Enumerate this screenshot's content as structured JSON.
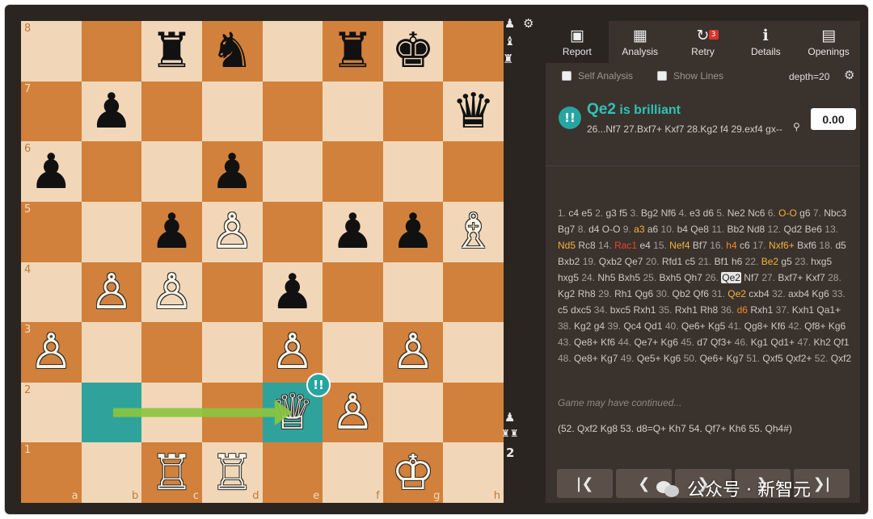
{
  "board": {
    "ranks": [
      "8",
      "7",
      "6",
      "5",
      "4",
      "3",
      "2",
      "1"
    ],
    "files": [
      "a",
      "b",
      "c",
      "d",
      "e",
      "f",
      "g",
      "h"
    ],
    "pieces": [
      {
        "sq": "c8",
        "glyph": "♜",
        "color": "b",
        "name": "black-rook-c8"
      },
      {
        "sq": "d8",
        "glyph": "♞",
        "color": "b",
        "name": "black-knight-d8"
      },
      {
        "sq": "f8",
        "glyph": "♜",
        "color": "b",
        "name": "black-rook-f8"
      },
      {
        "sq": "g8",
        "glyph": "♚",
        "color": "b",
        "name": "black-king-g8"
      },
      {
        "sq": "b7",
        "glyph": "♟",
        "color": "b",
        "name": "black-pawn-b7"
      },
      {
        "sq": "h7",
        "glyph": "♛",
        "color": "b",
        "name": "black-queen-h7"
      },
      {
        "sq": "a6",
        "glyph": "♟",
        "color": "b",
        "name": "black-pawn-a6"
      },
      {
        "sq": "d6",
        "glyph": "♟",
        "color": "b",
        "name": "black-pawn-d6"
      },
      {
        "sq": "c5",
        "glyph": "♟",
        "color": "b",
        "name": "black-pawn-c5"
      },
      {
        "sq": "d5",
        "glyph": "♙",
        "color": "w",
        "name": "white-pawn-d5"
      },
      {
        "sq": "f5",
        "glyph": "♟",
        "color": "b",
        "name": "black-pawn-f5"
      },
      {
        "sq": "g5",
        "glyph": "♟",
        "color": "b",
        "name": "black-pawn-g5"
      },
      {
        "sq": "h5",
        "glyph": "♗",
        "color": "w",
        "name": "white-bishop-h5"
      },
      {
        "sq": "b4",
        "glyph": "♙",
        "color": "w",
        "name": "white-pawn-b4"
      },
      {
        "sq": "c4",
        "glyph": "♙",
        "color": "w",
        "name": "white-pawn-c4"
      },
      {
        "sq": "e4",
        "glyph": "♟",
        "color": "b",
        "name": "black-pawn-e4"
      },
      {
        "sq": "a3",
        "glyph": "♙",
        "color": "w",
        "name": "white-pawn-a3"
      },
      {
        "sq": "e3",
        "glyph": "♙",
        "color": "w",
        "name": "white-pawn-e3"
      },
      {
        "sq": "g3",
        "glyph": "♙",
        "color": "w",
        "name": "white-pawn-g3"
      },
      {
        "sq": "e2",
        "glyph": "♕",
        "color": "w",
        "name": "white-queen-e2"
      },
      {
        "sq": "f2",
        "glyph": "♙",
        "color": "w",
        "name": "white-pawn-f2"
      },
      {
        "sq": "c1",
        "glyph": "♖",
        "color": "w",
        "name": "white-rook-c1"
      },
      {
        "sq": "d1",
        "glyph": "♖",
        "color": "w",
        "name": "white-rook-d1"
      },
      {
        "sq": "g1",
        "glyph": "♔",
        "color": "w",
        "name": "white-king-g1"
      }
    ],
    "highlight": [
      "b2",
      "e2"
    ],
    "last_move": {
      "from": "b2",
      "to": "e2"
    },
    "move_badge": "!!",
    "colors": {
      "light": "#f1d7b8",
      "dark": "#d1813c",
      "highlight": "#2fa39b",
      "arrow": "#8cc63f"
    }
  },
  "side_icons": {
    "top": [
      "pawn-icon",
      "bishop-icon",
      "rook-icon",
      "gear-icon"
    ],
    "bottom": [
      "pawn-icon",
      "rooks-icon",
      "score-2-icon"
    ],
    "bottom_glyphs": [
      "♟",
      "♜♜",
      "2"
    ]
  },
  "toolbar": {
    "items": [
      {
        "label": "Report",
        "icon": "report-icon",
        "glyph": "▣"
      },
      {
        "label": "Analysis",
        "icon": "analysis-icon",
        "glyph": "▦"
      },
      {
        "label": "Retry",
        "icon": "retry-icon",
        "glyph": "↻",
        "badge": "3"
      },
      {
        "label": "Details",
        "icon": "info-icon",
        "glyph": "ℹ"
      },
      {
        "label": "Openings",
        "icon": "openings-icon",
        "glyph": "▤"
      }
    ]
  },
  "options": {
    "self_analysis": "Self Analysis",
    "show_lines": "Show Lines",
    "depth": "depth=20"
  },
  "evaluation": {
    "badge": "!!",
    "move": "Qe2",
    "verdict": "is brilliant",
    "line": "26...Nf7 27.Bxf7+ Kxf7 28.Kg2 f4 29.exf4 gx--",
    "score": "0.00",
    "brilliant_color": "#2ec3b7"
  },
  "pgn": [
    {
      "n": "1."
    },
    {
      "m": "c4"
    },
    {
      "m": "e5"
    },
    {
      "n": "2."
    },
    {
      "m": "g3"
    },
    {
      "m": "f5"
    },
    {
      "n": "3."
    },
    {
      "m": "Bg2"
    },
    {
      "m": "Nf6"
    },
    {
      "n": "4."
    },
    {
      "m": "e3"
    },
    {
      "m": "d6"
    },
    {
      "n": "5."
    },
    {
      "m": "Ne2"
    },
    {
      "m": "Nc6"
    },
    {
      "n": "6."
    },
    {
      "m": "O-O",
      "c": "great"
    },
    {
      "m": "g6"
    },
    {
      "n": "7."
    },
    {
      "m": "Nbc3"
    },
    {
      "m": "Bg7"
    },
    {
      "n": "8."
    },
    {
      "m": "d4"
    },
    {
      "m": "O-O"
    },
    {
      "n": "9."
    },
    {
      "m": "a3",
      "c": "great"
    },
    {
      "m": "a6"
    },
    {
      "n": "10."
    },
    {
      "m": "b4"
    },
    {
      "m": "Qe8"
    },
    {
      "n": "11."
    },
    {
      "m": "Bb2"
    },
    {
      "m": "Nd8"
    },
    {
      "n": "12."
    },
    {
      "m": "Qd2"
    },
    {
      "m": "Be6"
    },
    {
      "n": "13."
    },
    {
      "m": "Nd5",
      "c": "great"
    },
    {
      "m": "Rc8"
    },
    {
      "n": "14."
    },
    {
      "m": "Rac1",
      "c": "bad"
    },
    {
      "m": "e4"
    },
    {
      "n": "15."
    },
    {
      "m": "Nef4",
      "c": "great"
    },
    {
      "m": "Bf7"
    },
    {
      "n": "16."
    },
    {
      "m": "h4",
      "c": "inacc"
    },
    {
      "m": "c6"
    },
    {
      "n": "17."
    },
    {
      "m": "Nxf6+",
      "c": "great"
    },
    {
      "m": "Bxf6"
    },
    {
      "n": "18."
    },
    {
      "m": "d5"
    },
    {
      "m": "Bxb2"
    },
    {
      "n": "19."
    },
    {
      "m": "Qxb2"
    },
    {
      "m": "Qe7"
    },
    {
      "n": "20."
    },
    {
      "m": "Rfd1"
    },
    {
      "m": "c5"
    },
    {
      "n": "21."
    },
    {
      "m": "Bf1"
    },
    {
      "m": "h6"
    },
    {
      "n": "22."
    },
    {
      "m": "Be2",
      "c": "great"
    },
    {
      "m": "g5"
    },
    {
      "n": "23."
    },
    {
      "m": "hxg5"
    },
    {
      "m": "hxg5"
    },
    {
      "n": "24."
    },
    {
      "m": "Nh5"
    },
    {
      "m": "Bxh5"
    },
    {
      "n": "25."
    },
    {
      "m": "Bxh5"
    },
    {
      "m": "Qh7"
    },
    {
      "n": "26."
    },
    {
      "m": "Qe2",
      "c": "cur"
    },
    {
      "m": "Nf7"
    },
    {
      "n": "27."
    },
    {
      "m": "Bxf7+"
    },
    {
      "m": "Kxf7"
    },
    {
      "n": "28."
    },
    {
      "m": "Kg2"
    },
    {
      "m": "Rh8"
    },
    {
      "n": "29."
    },
    {
      "m": "Rh1"
    },
    {
      "m": "Qg6"
    },
    {
      "n": "30."
    },
    {
      "m": "Qb2"
    },
    {
      "m": "Qf6"
    },
    {
      "n": "31."
    },
    {
      "m": "Qe2",
      "c": "great"
    },
    {
      "m": "cxb4"
    },
    {
      "n": "32."
    },
    {
      "m": "axb4"
    },
    {
      "m": "Kg6"
    },
    {
      "n": "33."
    },
    {
      "m": "c5"
    },
    {
      "m": "dxc5"
    },
    {
      "n": "34."
    },
    {
      "m": "bxc5"
    },
    {
      "m": "Rxh1"
    },
    {
      "n": "35."
    },
    {
      "m": "Rxh1"
    },
    {
      "m": "Rh8"
    },
    {
      "n": "36."
    },
    {
      "m": "d6",
      "c": "inacc"
    },
    {
      "m": "Rxh1"
    },
    {
      "n": "37."
    },
    {
      "m": "Kxh1"
    },
    {
      "m": "Qa1+"
    },
    {
      "n": "38."
    },
    {
      "m": "Kg2"
    },
    {
      "m": "g4"
    },
    {
      "n": "39."
    },
    {
      "m": "Qc4"
    },
    {
      "m": "Qd1"
    },
    {
      "n": "40."
    },
    {
      "m": "Qe6+"
    },
    {
      "m": "Kg5"
    },
    {
      "n": "41."
    },
    {
      "m": "Qg8+"
    },
    {
      "m": "Kf6"
    },
    {
      "n": "42."
    },
    {
      "m": "Qf8+"
    },
    {
      "m": "Kg6"
    },
    {
      "n": "43."
    },
    {
      "m": "Qe8+"
    },
    {
      "m": "Kf6"
    },
    {
      "n": "44."
    },
    {
      "m": "Qe7+"
    },
    {
      "m": "Kg6"
    },
    {
      "n": "45."
    },
    {
      "m": "d7"
    },
    {
      "m": "Qf3+"
    },
    {
      "n": "46."
    },
    {
      "m": "Kg1"
    },
    {
      "m": "Qd1+"
    },
    {
      "n": "47."
    },
    {
      "m": "Kh2"
    },
    {
      "m": "Qf1"
    },
    {
      "n": "48."
    },
    {
      "m": "Qe8+"
    },
    {
      "m": "Kg7"
    },
    {
      "n": "49."
    },
    {
      "m": "Qe5+"
    },
    {
      "m": "Kg6"
    },
    {
      "n": "50."
    },
    {
      "m": "Qe6+"
    },
    {
      "m": "Kg7"
    },
    {
      "n": "51."
    },
    {
      "m": "Qxf5"
    },
    {
      "m": "Qxf2+"
    },
    {
      "n": "52."
    },
    {
      "m": "Qxf2"
    }
  ],
  "continued_label": "Game may have continued...",
  "continuation": "(52. Qxf2 Kg8 53. d8=Q+ Kh7 54. Qf7+ Kh6 55. Qh4#)",
  "nav": {
    "buttons": [
      {
        "glyph": "|❮",
        "name": "first-move-button"
      },
      {
        "glyph": "❮",
        "name": "prev-move-button"
      },
      {
        "glyph": "❯",
        "name": "next-move-button"
      },
      {
        "glyph": "❯",
        "name": "play-button"
      },
      {
        "glyph": "❯|",
        "name": "last-move-button"
      }
    ]
  },
  "watermark": {
    "text": "公众号 · 新智元"
  }
}
